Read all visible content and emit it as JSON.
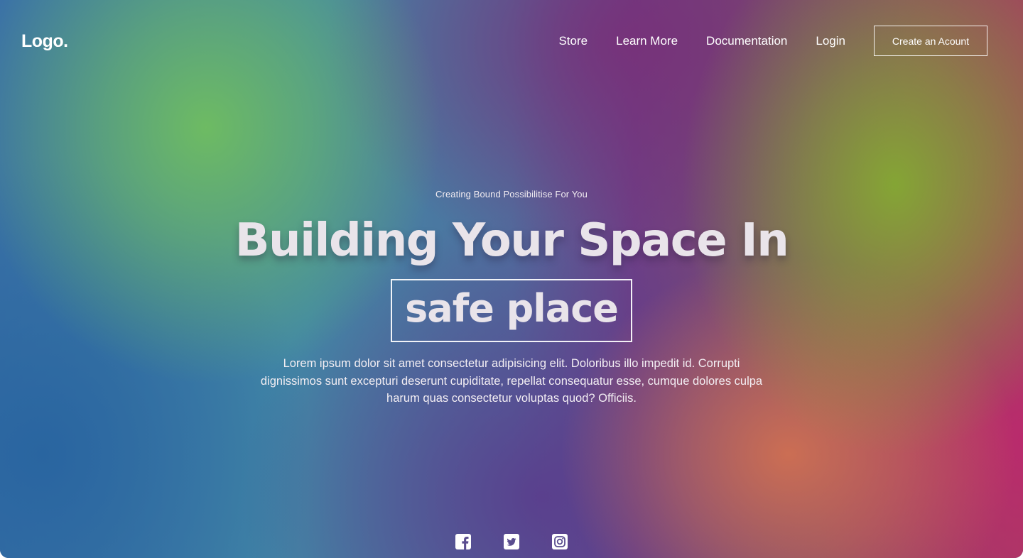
{
  "nav": {
    "logo": "Logo.",
    "links": [
      "Store",
      "Learn More",
      "Documentation",
      "Login"
    ],
    "cta_label": "Create an Acount"
  },
  "hero": {
    "eyebrow": "Creating Bound Possibilitise For You",
    "headline": "Building Your Space In",
    "highlight": "safe place",
    "description": "Lorem ipsum dolor sit amet consectetur adipisicing elit. Doloribus illo impedit id. Corrupti dignissimos sunt excepturi deserunt cupiditate, repellat consequatur esse, cumque dolores culpa harum quas consectetur voluptas quod? Officiis."
  },
  "social": {
    "icons": [
      "facebook-icon",
      "twitter-icon",
      "instagram-icon"
    ]
  },
  "colors": {
    "text": "#ffffff",
    "headline": "#e9e4ea"
  }
}
